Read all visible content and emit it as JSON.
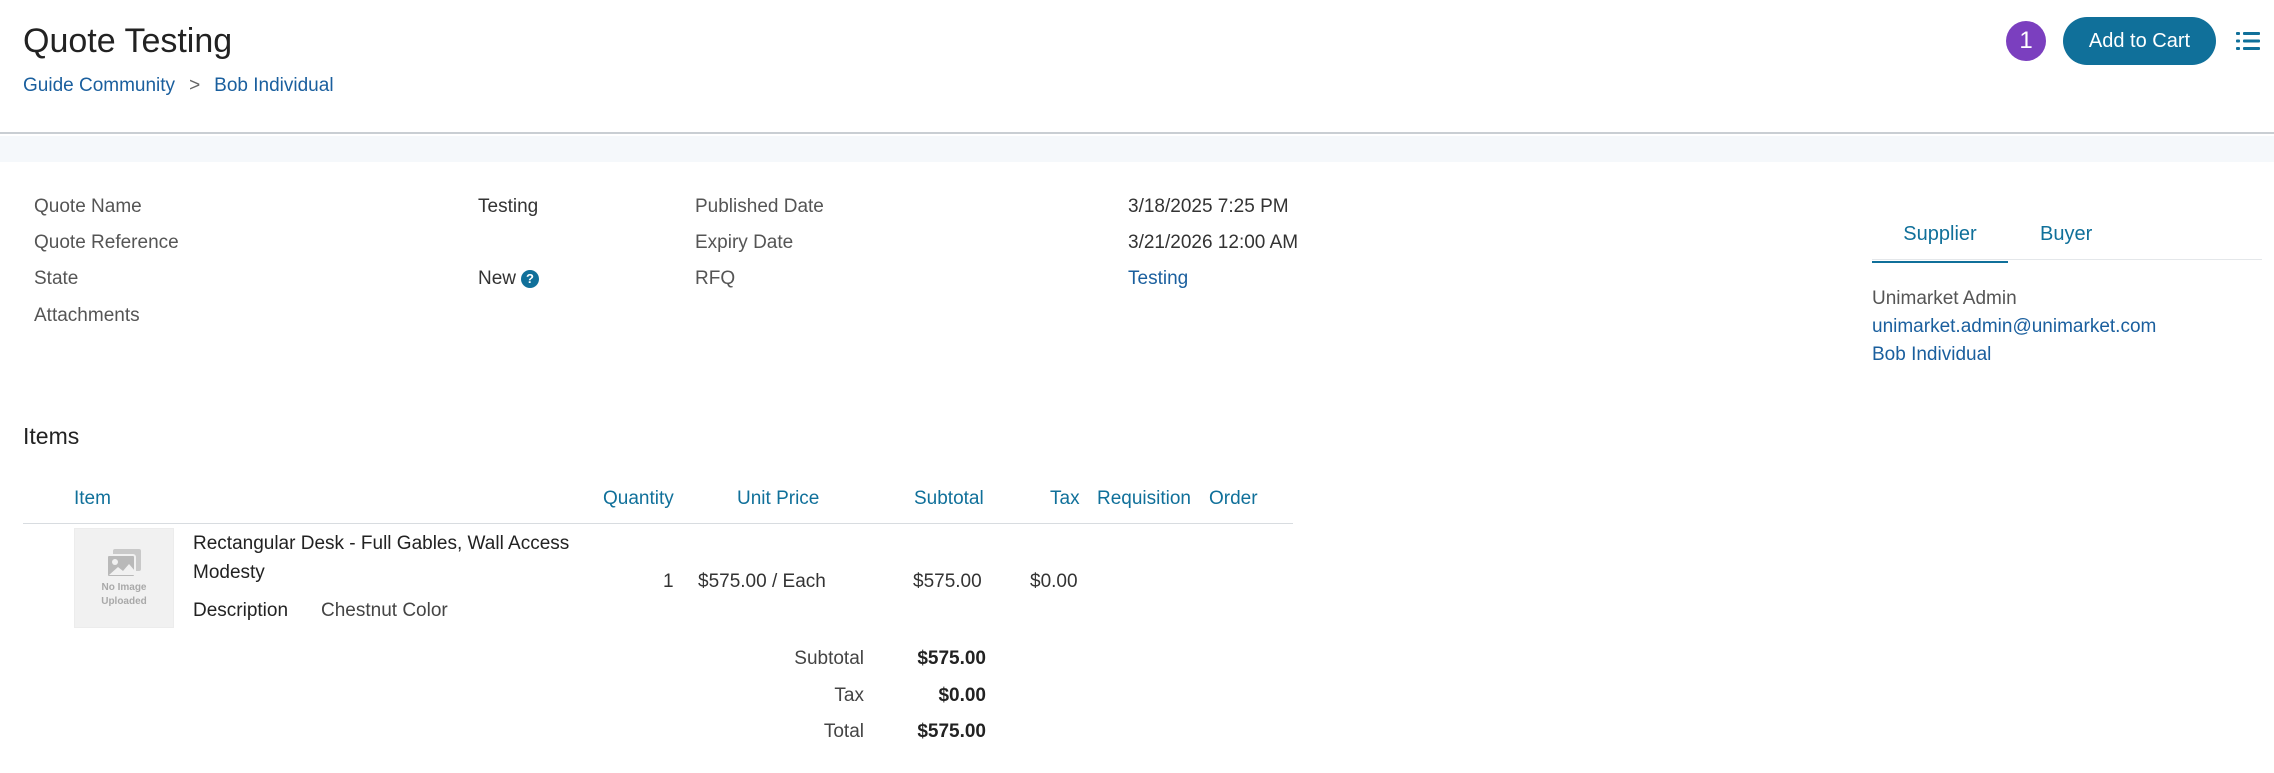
{
  "header": {
    "title": "Quote Testing",
    "breadcrumb": [
      "Guide Community",
      "Bob Individual"
    ],
    "breadcrumb_separator": ">",
    "badge_count": "1",
    "add_to_cart_label": "Add to Cart",
    "menu_icon": "list-icon"
  },
  "details": {
    "quote_name_label": "Quote Name",
    "quote_name_value": "Testing",
    "quote_reference_label": "Quote Reference",
    "state_label": "State",
    "state_value": "New",
    "state_help_glyph": "?",
    "attachments_label": "Attachments",
    "published_date_label": "Published Date",
    "published_date_value": "3/18/2025 7:25 PM",
    "expiry_date_label": "Expiry Date",
    "expiry_date_value": "3/21/2026 12:00 AM",
    "rfq_label": "RFQ",
    "rfq_value": "Testing"
  },
  "contact_tabs": {
    "tabs": [
      "Supplier",
      "Buyer"
    ],
    "active": "Supplier",
    "supplier": {
      "name": "Unimarket Admin",
      "email": "unimarket.admin@unimarket.com",
      "organisation": "Bob Individual"
    }
  },
  "items": {
    "title": "Items",
    "columns": [
      "Item",
      "Quantity",
      "Unit Price",
      "Subtotal",
      "Tax",
      "Requisition",
      "Order"
    ],
    "rows": [
      {
        "image_text": [
          "No Image",
          "Uploaded"
        ],
        "name": "Rectangular Desk - Full Gables, Wall Access Modesty",
        "description_label": "Description",
        "description_value": "Chestnut Color",
        "quantity": "1",
        "unit_price": "$575.00 / Each",
        "subtotal": "$575.00",
        "tax": "$0.00",
        "requisition": "",
        "order": ""
      }
    ],
    "totals": {
      "subtotal_label": "Subtotal",
      "subtotal_value": "$575.00",
      "tax_label": "Tax",
      "tax_value": "$0.00",
      "total_label": "Total",
      "total_value": "$575.00"
    }
  },
  "colors": {
    "accent": "#10709a",
    "link": "#1a5f9e",
    "badge": "#7b3fbf"
  }
}
